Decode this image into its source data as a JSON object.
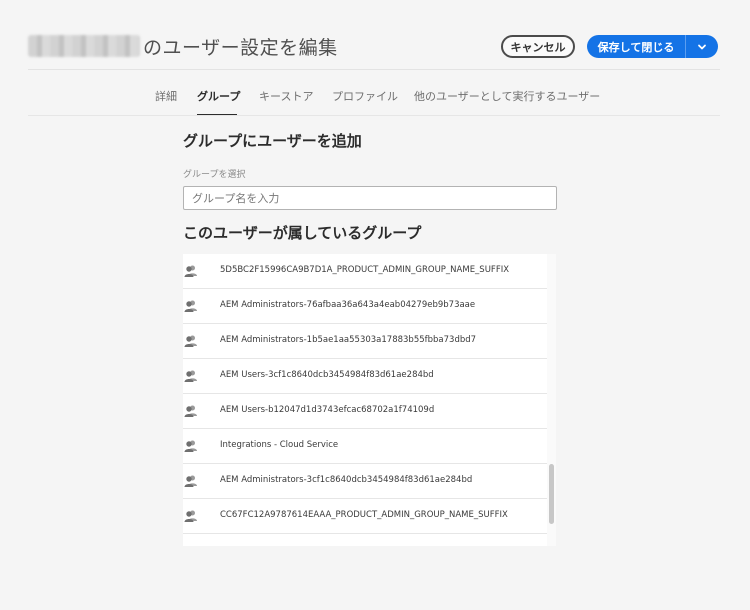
{
  "header": {
    "title_suffix": "のユーザー設定を編集",
    "cancel_label": "キャンセル",
    "save_label": "保存して閉じる",
    "dropdown_icon": "chevron-down-icon"
  },
  "tabs": [
    {
      "label": "詳細",
      "active": false
    },
    {
      "label": "グループ",
      "active": true
    },
    {
      "label": "キーストア",
      "active": false
    },
    {
      "label": "プロファイル",
      "active": false
    },
    {
      "label": "他のユーザーとして実行するユーザー",
      "active": false
    }
  ],
  "add_group": {
    "heading": "グループにユーザーを追加",
    "field_label": "グループを選択",
    "placeholder": "グループ名を入力"
  },
  "member_groups": {
    "heading": "このユーザーが属しているグループ",
    "icon": "user-group-icon",
    "items": [
      "5D5BC2F15996CA9B7D1A_PRODUCT_ADMIN_GROUP_NAME_SUFFIX",
      "AEM Administrators-76afbaa36a643a4eab04279eb9b73aae",
      "AEM Administrators-1b5ae1aa55303a17883b55fbba73dbd7",
      "AEM Users-3cf1c8640dcb3454984f83d61ae284bd",
      "AEM Users-b12047d1d3743efcac68702a1f74109d",
      "Integrations - Cloud Service",
      "AEM Administrators-3cf1c8640dcb3454984f83d61ae284bd",
      "CC67FC12A9787614EAAA_PRODUCT_ADMIN_GROUP_NAME_SUFFIX"
    ]
  },
  "colors": {
    "accent": "#1473e6",
    "background": "#f5f5f5"
  }
}
